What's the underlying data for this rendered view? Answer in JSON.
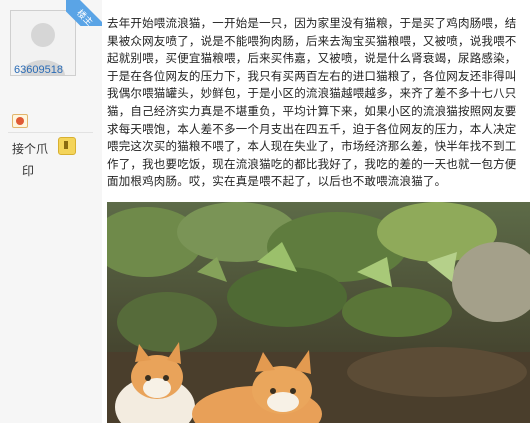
{
  "sidebar": {
    "badge_text": "楼主",
    "username": "63609518",
    "action_line1": "接个爪",
    "action_line2": "印"
  },
  "post": {
    "body": "去年开始喂流浪猫，一开始是一只，因为家里没有猫粮，于是买了鸡肉肠喂，结果被众网友喷了，说是不能喂狗肉肠，后来去淘宝买猫粮喂，又被喷，说我喂不起就别喂，买便宜猫粮喂，后来买伟嘉，又被喷，说是什么肾衰竭，尿路感染，于是在各位网友的压力下，我只有买两百左右的进口猫粮了，各位网友还非得叫我偶尔喂猫罐头，妙鲜包，于是小区的流浪猫越喂越多，来齐了差不多十七八只猫，自己经济实力真是不堪重负，平均计算下来，如果小区的流浪猫按照网友要求每天喂饱，本人差不多一个月支出在四五千，迫于各位网友的压力，本人决定喂完这次买的猫粮不喂了，本人现在失业了，市场经济那么差，快半年找不到工作了，我也要吃饭，现在流浪猫吃的都比我好了，我吃的差的一天也就一包方便面加根鸡肉肠。哎，实在真是喂不起了，以后也不敢喂流浪猫了。"
  },
  "photo": {
    "subject": "two orange-and-white kittens among green leaves"
  },
  "colors": {
    "link_blue": "#2a6bb5",
    "badge_blue": "#5aa4e6",
    "sidebar_bg": "#f6f6f6"
  }
}
